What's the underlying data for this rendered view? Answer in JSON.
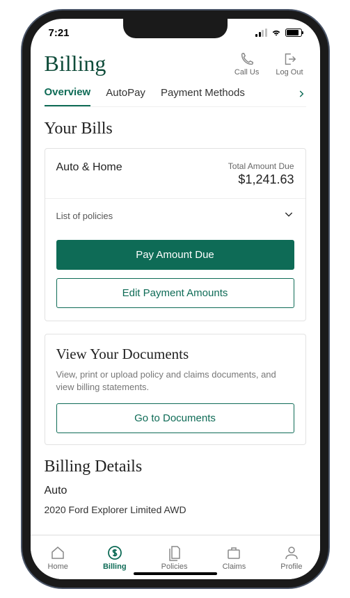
{
  "status": {
    "time": "7:21"
  },
  "header": {
    "title": "Billing",
    "actions": {
      "call": "Call Us",
      "logout": "Log Out"
    },
    "tabs": [
      "Overview",
      "AutoPay",
      "Payment Methods"
    ]
  },
  "bills": {
    "section_title": "Your Bills",
    "account_label": "Auto & Home",
    "total_due_label": "Total Amount Due",
    "total_due_amount": "$1,241.63",
    "policies_label": "List of policies",
    "pay_button": "Pay Amount Due",
    "edit_button": "Edit Payment Amounts"
  },
  "documents": {
    "title": "View Your Documents",
    "description": "View, print or upload policy and claims documents, and view billing statements.",
    "button": "Go to Documents"
  },
  "details": {
    "title": "Billing Details",
    "category": "Auto",
    "item": "2020 Ford Explorer Limited AWD"
  },
  "tabbar": {
    "home": "Home",
    "billing": "Billing",
    "policies": "Policies",
    "claims": "Claims",
    "profile": "Profile"
  }
}
